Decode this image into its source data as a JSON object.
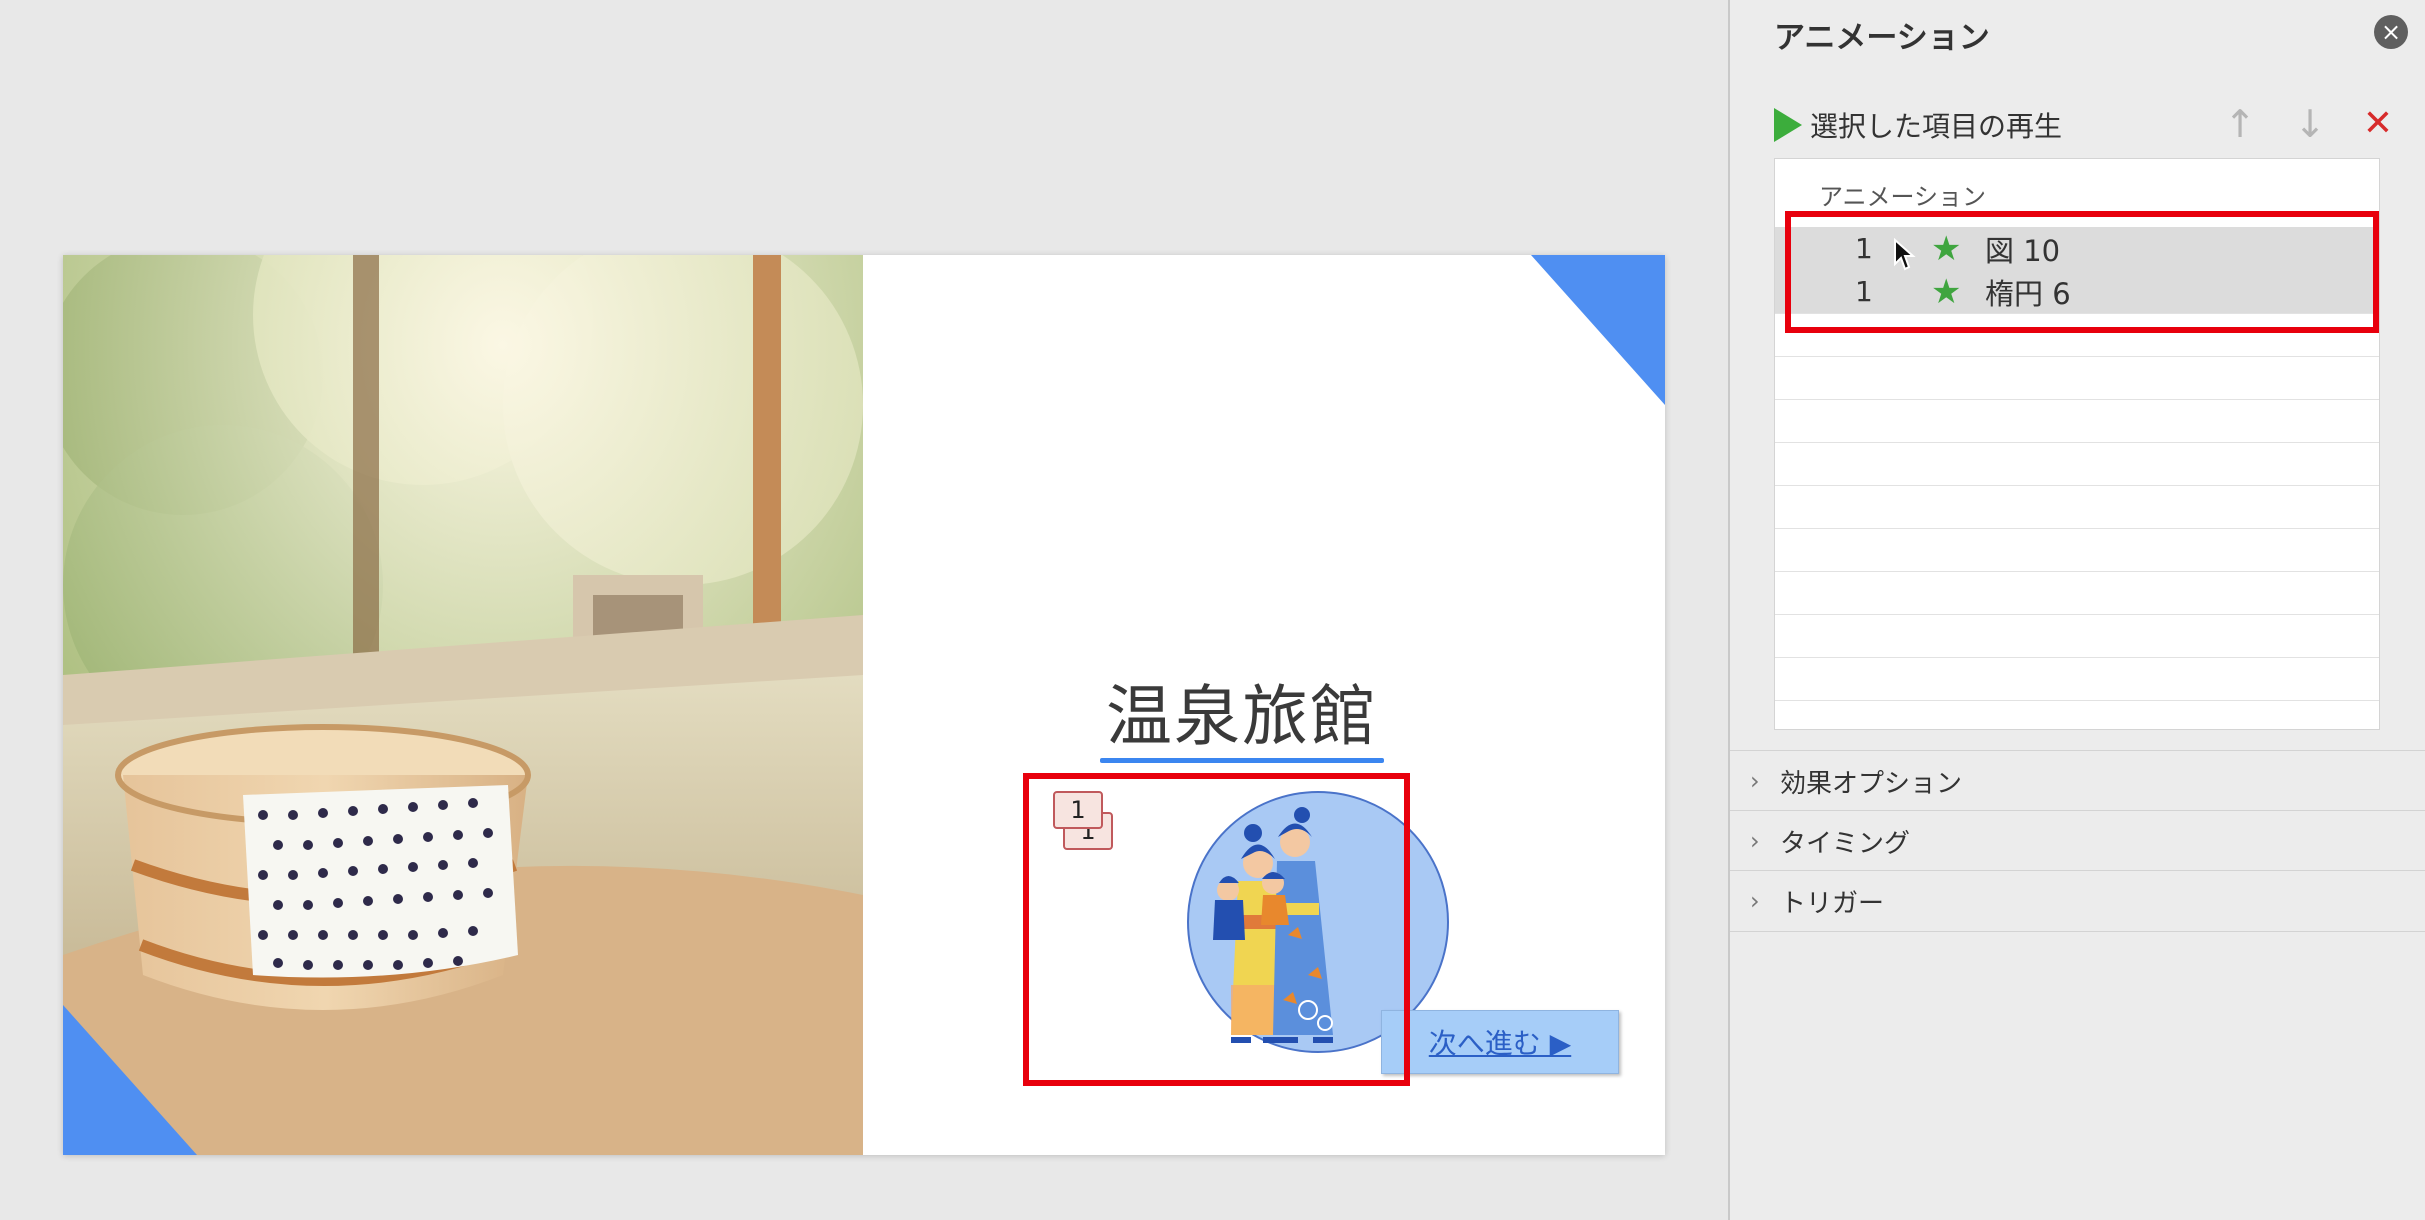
{
  "slide": {
    "title": "温泉旅館",
    "next_button": "次へ進む ▶",
    "anim_tag_front": "1",
    "anim_tag_back": "1",
    "accent_color": "#4f8ff2"
  },
  "panel": {
    "title": "アニメーション",
    "close_icon": "×",
    "play_label": "選択した項目の再生",
    "move_up_icon": "↑",
    "move_down_icon": "↓",
    "remove_icon": "✕",
    "list_header": "アニメーション",
    "items": [
      {
        "order": "1",
        "icon": "★",
        "name": "図 10"
      },
      {
        "order": "1",
        "icon": "★",
        "name": "楕円 6"
      }
    ],
    "sections": [
      {
        "chevron": "›",
        "label": "効果オプション"
      },
      {
        "chevron": "›",
        "label": "タイミング"
      },
      {
        "chevron": "›",
        "label": "トリガー"
      }
    ]
  }
}
